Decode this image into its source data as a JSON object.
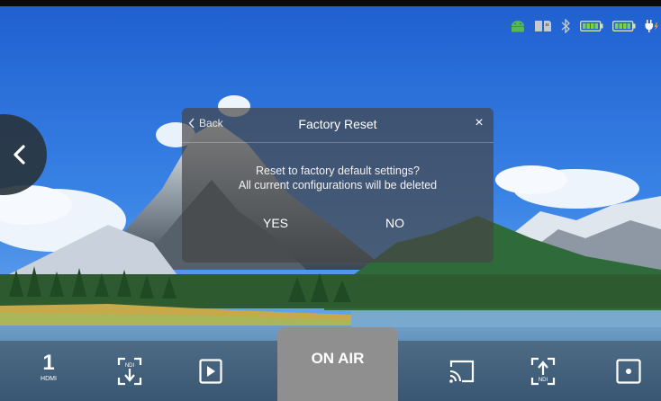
{
  "status_icons": [
    "android-icon",
    "sd-card-icon",
    "bluetooth-icon",
    "battery-icon",
    "battery-icon",
    "power-plug-icon"
  ],
  "colors": {
    "accent_green": "#58b84a",
    "onair_bg": "#8f8f8f",
    "dialog_bg": "rgba(70,70,70,0.70)"
  },
  "dialog": {
    "back_label": "Back",
    "title": "Factory Reset",
    "close_glyph": "×",
    "message_line1": "Reset to factory default settings?",
    "message_line2": "All current configurations will be deleted",
    "yes_label": "YES",
    "no_label": "NO"
  },
  "bottom_bar": {
    "source_number": "1",
    "source_label": "HDMI",
    "ndi_in_label": "NDI",
    "ndi_out_label": "NDI",
    "onair_label": "ON AIR"
  }
}
